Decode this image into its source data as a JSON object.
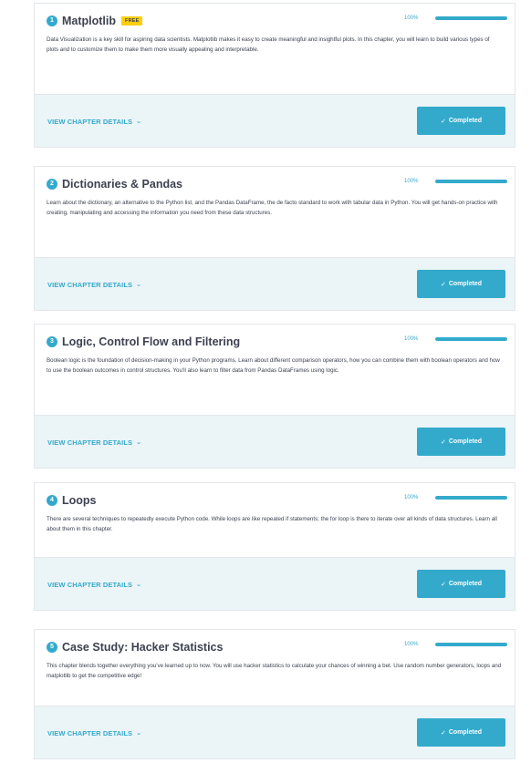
{
  "chapters": [
    {
      "number": "1",
      "title": "Matplotlib",
      "badge": "FREE",
      "progress_text": "100%",
      "progress": 1.0,
      "description": "Data Visualization is a key skill for aspiring data scientists. Matplotlib makes it easy to create meaningful and insightful plots. In this chapter, you will learn to build various types of plots and to customize them to make them more visually appealing and interpretable.",
      "details_label": "VIEW CHAPTER DETAILS",
      "button_label": "Completed"
    },
    {
      "number": "2",
      "title": "Dictionaries & Pandas",
      "badge": "",
      "progress_text": "100%",
      "progress": 1.0,
      "description": "Learn about the dictionary, an alternative to the Python list, and the Pandas DataFrame, the de facto standard to work with tabular data in Python. You will get hands-on practice with creating, manipulating and accessing the information you need from these data structures.",
      "details_label": "VIEW CHAPTER DETAILS",
      "button_label": "Completed"
    },
    {
      "number": "3",
      "title": "Logic, Control Flow and Filtering",
      "badge": "",
      "progress_text": "100%",
      "progress": 1.0,
      "description": "Boolean logic is the foundation of decision-making in your Python programs. Learn about different comparison operators, how you can combine them with boolean operators and how to use the boolean outcomes in control structures. You'll also learn to filter data from Pandas DataFrames using logic.",
      "details_label": "VIEW CHAPTER DETAILS",
      "button_label": "Completed"
    },
    {
      "number": "4",
      "title": "Loops",
      "badge": "",
      "progress_text": "100%",
      "progress": 1.0,
      "description": "There are several techniques to repeatedly execute Python code. While loops are like repeated if statements; the for loop is there to iterate over all kinds of data structures. Learn all about them in this chapter.",
      "details_label": "VIEW CHAPTER DETAILS",
      "button_label": "Completed"
    },
    {
      "number": "5",
      "title": "Case Study: Hacker Statistics",
      "badge": "",
      "progress_text": "100%",
      "progress": 1.0,
      "description": "This chapter blends together everything you've learned up to now. You will use hacker statistics to calculate your chances of winning a bet. Use random number generators, loops and matplotlib to get the competitive edge!",
      "details_label": "VIEW CHAPTER DETAILS",
      "button_label": "Completed"
    }
  ],
  "icons": {
    "details": "chevron-down-icon",
    "button": "checkmark-icon"
  },
  "colors": {
    "accent": "#33aacc",
    "badge": "#fcce0d",
    "footer": "#ebf4f7",
    "text": "#3d4251"
  }
}
